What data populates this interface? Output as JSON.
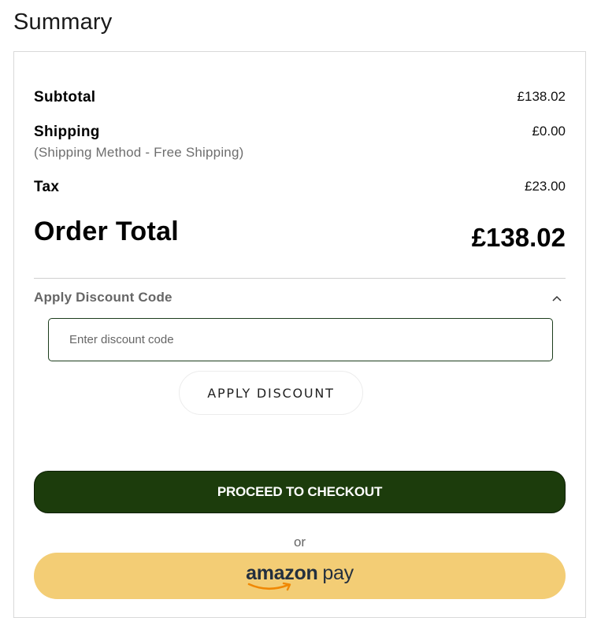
{
  "page": {
    "title": "Summary"
  },
  "summary": {
    "subtotal": {
      "label": "Subtotal",
      "value": "£138.02"
    },
    "shipping": {
      "label": "Shipping",
      "method": "(Shipping Method - Free Shipping)",
      "value": "£0.00"
    },
    "tax": {
      "label": "Tax",
      "value": "£23.00"
    },
    "order_total": {
      "label": "Order Total",
      "value": "£138.02"
    }
  },
  "discount": {
    "title": "Apply Discount Code",
    "expanded": true,
    "input_placeholder": "Enter discount code",
    "input_value": "",
    "apply_label": "APPLY DISCOUNT"
  },
  "actions": {
    "checkout_label": "PROCEED TO CHECKOUT",
    "or_text": "or",
    "amazon_pay": {
      "brand": "amazon",
      "word": "pay",
      "logo_icon": "amazon-pay-logo"
    }
  },
  "colors": {
    "checkout_bg": "#1c3c0c",
    "amazon_pay_bg": "#f3cd75",
    "amazon_smile": "#f08804",
    "input_border": "#1c3d1c"
  }
}
